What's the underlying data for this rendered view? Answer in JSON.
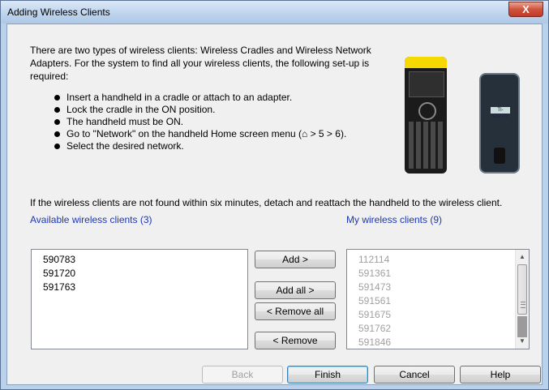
{
  "window": {
    "title": "Adding Wireless Clients",
    "close_label": "X"
  },
  "intro": "There are two types of wireless clients: Wireless Cradles and Wireless Network Adapters. For the system to find all your wireless clients, the following set-up is required:",
  "steps": [
    "Insert a handheld in a cradle or attach to an adapter.",
    "Lock the cradle in the ON position.",
    "The handheld must be ON.",
    "Go to \"Network\" on the handheld Home screen menu (⌂ > 5 > 6).",
    "Select the desired network."
  ],
  "note": "If the wireless clients are not found within six minutes, detach and reattach the handheld to the wireless client.",
  "available": {
    "label": "Available wireless clients (3)",
    "items": [
      "590783",
      "591720",
      "591763"
    ]
  },
  "mine": {
    "label": "My wireless clients (9)",
    "items": [
      "112114",
      "591361",
      "591473",
      "591561",
      "591675",
      "591762",
      "591846"
    ]
  },
  "buttons": {
    "add": "Add >",
    "add_all": "Add all >",
    "remove_all": "< Remove all",
    "remove": "< Remove",
    "back": "Back",
    "finish": "Finish",
    "cancel": "Cancel",
    "help": "Help"
  },
  "device_logo": "TI-NSPIRE",
  "colors": {
    "link_blue": "#1c36b6",
    "disabled_text": "#a0a0a0"
  }
}
